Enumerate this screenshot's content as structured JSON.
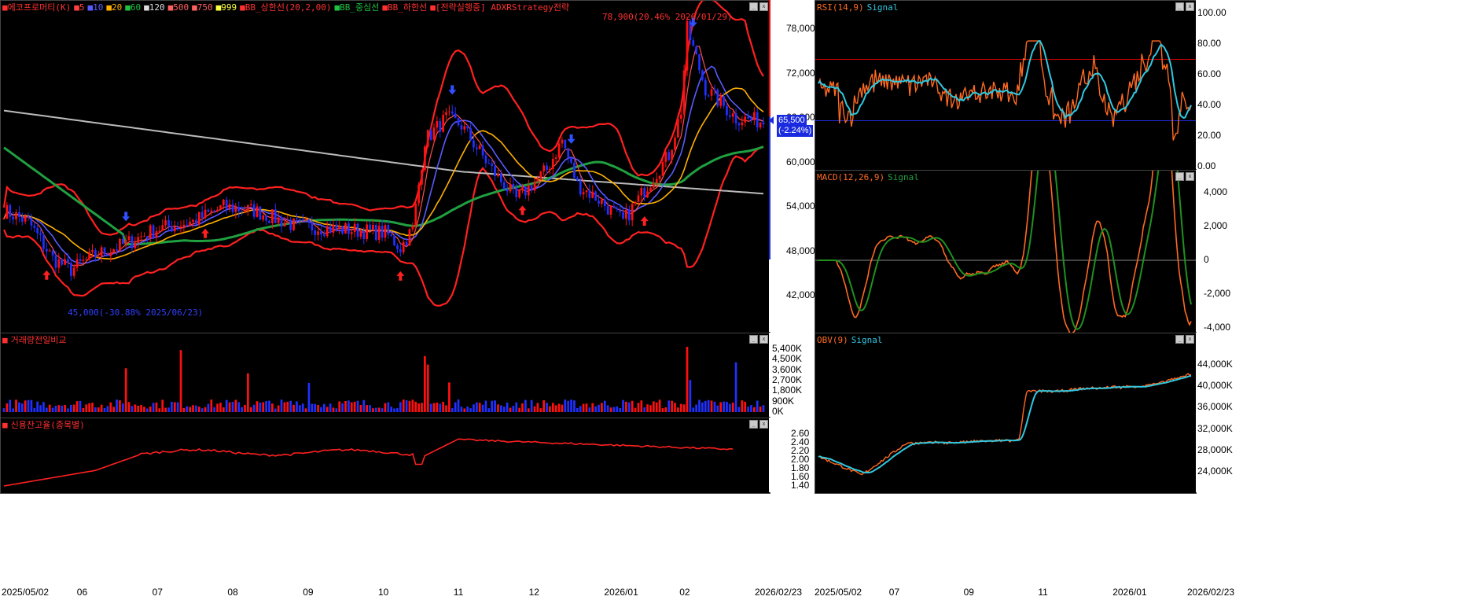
{
  "main_chart": {
    "legend": [
      {
        "text": "에코프로머티(K)",
        "color": "#ff3030"
      },
      {
        "text": "5",
        "color": "#ff4040"
      },
      {
        "text": "10",
        "color": "#5a5aff"
      },
      {
        "text": "20",
        "color": "#ffb000"
      },
      {
        "text": "60",
        "color": "#20c040"
      },
      {
        "text": "120",
        "color": "#dddddd"
      },
      {
        "text": "500",
        "color": "#ff6060"
      },
      {
        "text": "750",
        "color": "#ff6060"
      },
      {
        "text": "999",
        "color": "#ffff40"
      },
      {
        "text": "BB_상한선(20,2,00)",
        "color": "#ff3030"
      },
      {
        "text": "BB_중심선",
        "color": "#20c040"
      },
      {
        "text": "BB_하한선",
        "color": "#ff3030"
      },
      {
        "text": "[전략실행중] ADXRStrategy전략",
        "color": "#ff3030"
      }
    ],
    "high_annotation": "78,900(20.46% 2026/01/29)",
    "low_annotation": "45,000(-30.88% 2025/06/23)",
    "price_label": "65,500",
    "change_label": "(-2.24%)",
    "y_ticks": [
      "78,000",
      "72,000",
      "66,000",
      "60,000",
      "54,000",
      "48,000",
      "42,000"
    ]
  },
  "volume_chart": {
    "legend": "거래량전일비교",
    "y_ticks": [
      "5,400K",
      "4,500K",
      "3,600K",
      "2,700K",
      "1,800K",
      "900K",
      "0K"
    ]
  },
  "credit_chart": {
    "legend": "신용잔고율(종목별)",
    "y_ticks": [
      "2.60",
      "2.40",
      "2.20",
      "2.00",
      "1.80",
      "1.60",
      "1.40"
    ]
  },
  "rsi_chart": {
    "legend_a": "RSI(14,9)",
    "legend_b": "Signal",
    "y_ticks": [
      "100.00",
      "80.00",
      "60.00",
      "40.00",
      "20.00",
      "0.00"
    ]
  },
  "macd_chart": {
    "legend_a": "MACD(12,26,9)",
    "legend_b": "Signal",
    "y_ticks": [
      "4,000",
      "2,000",
      "0",
      "-2,000",
      "-4,000"
    ]
  },
  "obv_chart": {
    "legend_a": "OBV(9)",
    "legend_b": "Signal",
    "y_ticks": [
      "44,000K",
      "40,000K",
      "36,000K",
      "32,000K",
      "28,000K",
      "24,000K"
    ]
  },
  "x_axis_left": [
    "2025/05/02",
    "06",
    "07",
    "08",
    "09",
    "10",
    "11",
    "12",
    "2026/01",
    "02",
    "2026/02/23"
  ],
  "x_axis_right": [
    "2025/05/02",
    "07",
    "09",
    "11",
    "2026/01",
    "2026/02/23"
  ],
  "colors": {
    "up": "#ff1010",
    "down": "#2030ff",
    "bb": "#ff2020",
    "ma60": "#20a040",
    "ma120": "#bbbbbb",
    "ma20": "#ffb000",
    "ma10": "#5a5aff",
    "ma5": "#ff5050",
    "rsi": "#ff6a20",
    "sig": "#30c8e0",
    "macd_sig": "#209020"
  }
}
